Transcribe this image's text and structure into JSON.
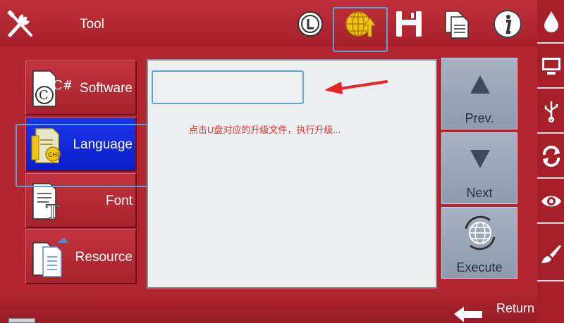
{
  "header": {
    "title": "Tool",
    "icons": [
      "tools-icon",
      "clock-icon",
      "upgrade-globe-icon",
      "save-icon",
      "document-icon",
      "info-icon"
    ]
  },
  "menu": {
    "items": [
      {
        "label": "Software",
        "icon": "software-file-icon"
      },
      {
        "label": "Language",
        "icon": "language-file-icon",
        "active": true
      },
      {
        "label": "Font",
        "icon": "font-file-icon"
      },
      {
        "label": "Resource",
        "icon": "resource-file-icon"
      }
    ]
  },
  "content": {
    "file_input_value": "",
    "hint": "点击U盘对应的升级文件，执行升级..."
  },
  "side_buttons": {
    "prev": "Prev.",
    "next": "Next",
    "execute": "Execute"
  },
  "footer": {
    "return_label": "Return"
  },
  "right_strip": {
    "icons": [
      "ink-drop-icon",
      "monitor-icon",
      "usb-icon",
      "refresh-icon",
      "eye-icon",
      "brush-icon"
    ]
  },
  "colors": {
    "primary_red": "#b32530",
    "active_blue": "#0a1fcc",
    "side_button_gray": "#9aa6b7",
    "hint_red": "#e63030",
    "highlight_blue": "#5aa6d8",
    "icon_yellow": "#f2c40c"
  }
}
